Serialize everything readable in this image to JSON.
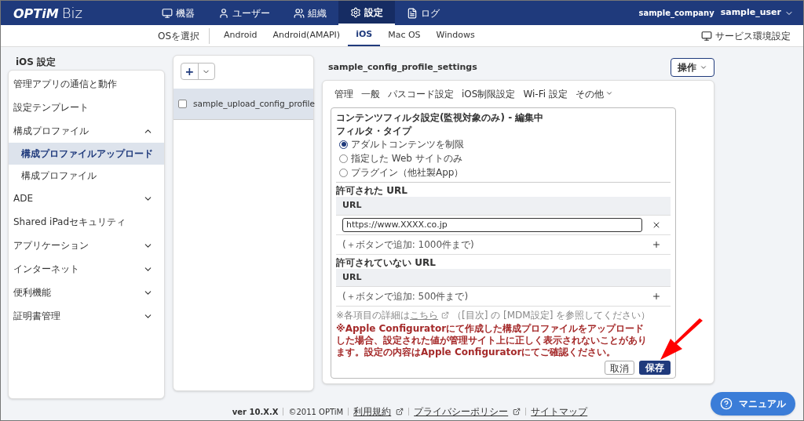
{
  "header": {
    "logo": "OPTiM",
    "product": "Biz",
    "nav": [
      {
        "label": "機器",
        "selected": false
      },
      {
        "label": "ユーザー",
        "selected": false
      },
      {
        "label": "組織",
        "selected": false
      },
      {
        "label": "設定",
        "selected": true
      },
      {
        "label": "ログ",
        "selected": false
      }
    ],
    "company": "sample_company",
    "user": "sample_user"
  },
  "os_bar": {
    "label": "OSを選択",
    "tabs": [
      {
        "label": "Android",
        "selected": false
      },
      {
        "label": "Android(AMAPI)",
        "selected": false
      },
      {
        "label": "iOS",
        "selected": true
      },
      {
        "label": "Mac OS",
        "selected": false
      },
      {
        "label": "Windows",
        "selected": false
      }
    ],
    "service_settings": "サービス環境設定"
  },
  "sidebar": {
    "title": "iOS 設定",
    "items": [
      {
        "label": "管理アプリの通信と動作",
        "kind": "link"
      },
      {
        "label": "設定テンプレート",
        "kind": "link"
      },
      {
        "label": "構成プロファイル",
        "kind": "group",
        "expanded": true,
        "children": [
          {
            "label": "構成プロファイルアップロード",
            "selected": true
          },
          {
            "label": "構成プロファイル",
            "selected": false
          }
        ]
      },
      {
        "label": "ADE",
        "kind": "group",
        "expanded": false
      },
      {
        "label": "Shared iPadセキュリティ",
        "kind": "link"
      },
      {
        "label": "アプリケーション",
        "kind": "group",
        "expanded": false
      },
      {
        "label": "インターネット",
        "kind": "group",
        "expanded": false
      },
      {
        "label": "便利機能",
        "kind": "group",
        "expanded": false
      },
      {
        "label": "証明書管理",
        "kind": "group",
        "expanded": false
      }
    ]
  },
  "profiles": {
    "add": "+",
    "items": [
      {
        "label": "sample_upload_config_profile",
        "checked": false,
        "selected": true
      }
    ]
  },
  "detail": {
    "title": "sample_config_profile_settings",
    "action": "操作",
    "tabs": [
      {
        "label": "管理",
        "kind": "tab"
      },
      {
        "label": "一般",
        "kind": "tab"
      },
      {
        "label": "パスコード設定",
        "kind": "tab"
      },
      {
        "label": "iOS制限設定",
        "kind": "tab"
      },
      {
        "label": "Wi-Fi 設定",
        "kind": "tab"
      },
      {
        "label": "その他",
        "kind": "menu"
      }
    ],
    "panel": {
      "title": "コンテンツフィルタ設定(監視対象のみ) - 編集中",
      "filter_label": "フィルタ・タイプ",
      "filter_options": [
        {
          "label": "アダルトコンテンツを制限",
          "selected": true
        },
        {
          "label": "指定した Web サイトのみ",
          "selected": false
        },
        {
          "label": "プラグイン（他社製App）",
          "selected": false
        }
      ],
      "allowed": {
        "label": "許可された URL",
        "column": "URL",
        "entries": [
          "https://www.XXXX.co.jp"
        ],
        "add_hint": "(＋ボタンで追加: 1000件まで)"
      },
      "blocked": {
        "label": "許可されていない URL",
        "column": "URL",
        "add_hint": "(＋ボタンで追加: 500件まで)"
      },
      "note_prefix": "※各項目の詳細は",
      "note_link": "こちら",
      "note_suffix": "（[目次] の [MDM設定] を参照してください）",
      "warning": "※Apple Configuratorにて作成した構成プロファイルをアップロードした場合、設定された値が管理サイト上に正しく表示されないことがあります。設定の内容はApple Configuratorにてご確認ください。",
      "cancel": "取消",
      "save": "保存"
    }
  },
  "footer": {
    "version": "ver 10.X.X",
    "copyright": "©2011 OPTiM",
    "links": [
      {
        "label": "利用規約",
        "external": true
      },
      {
        "label": "プライバシーポリシー",
        "external": true
      },
      {
        "label": "サイトマップ",
        "external": false
      }
    ]
  },
  "manual": "マニュアル"
}
